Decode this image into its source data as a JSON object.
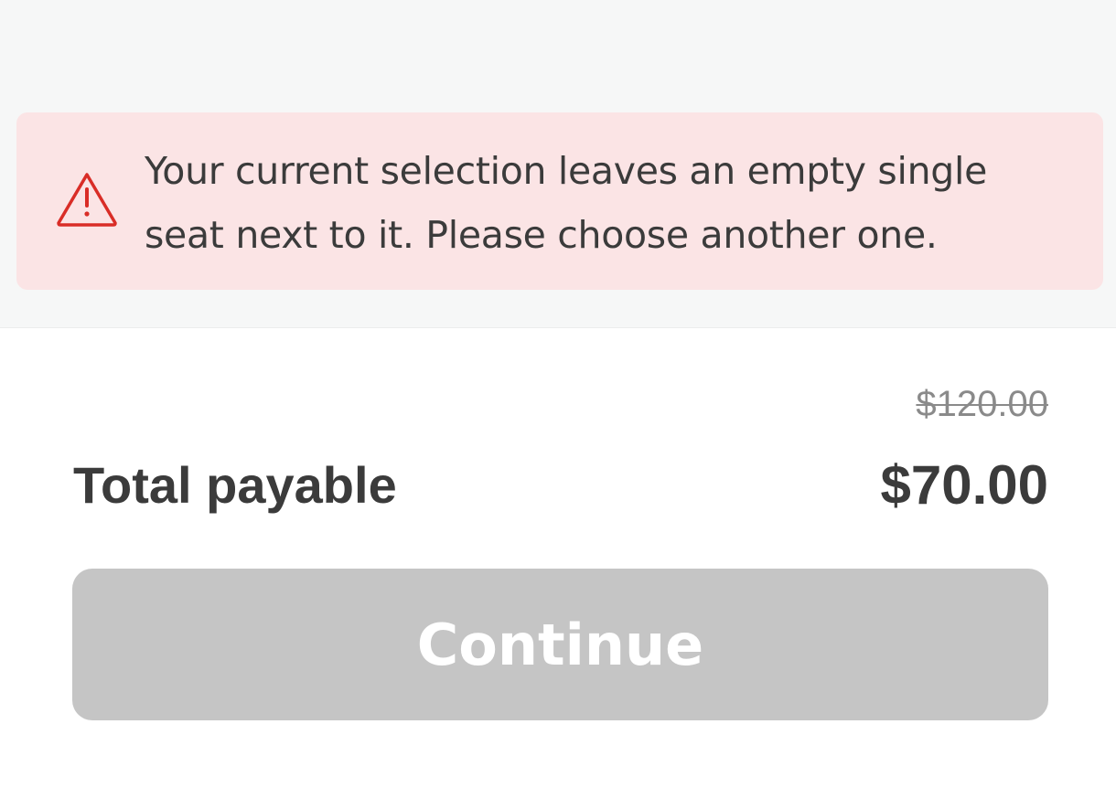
{
  "alert": {
    "icon": "warning-triangle-icon",
    "message": "Your current selection leaves an empty single seat next to it. Please choose another one."
  },
  "summary": {
    "original_price": "$120.00",
    "total_label": "Total payable",
    "total_amount": "$70.00"
  },
  "actions": {
    "continue_label": "Continue"
  },
  "colors": {
    "page_background": "#ffffff",
    "alert_background": "#fbe4e5",
    "warning_accent": "#d92d27",
    "text_primary": "#3b3b3b",
    "disabled_button": "#c5c5c5"
  }
}
